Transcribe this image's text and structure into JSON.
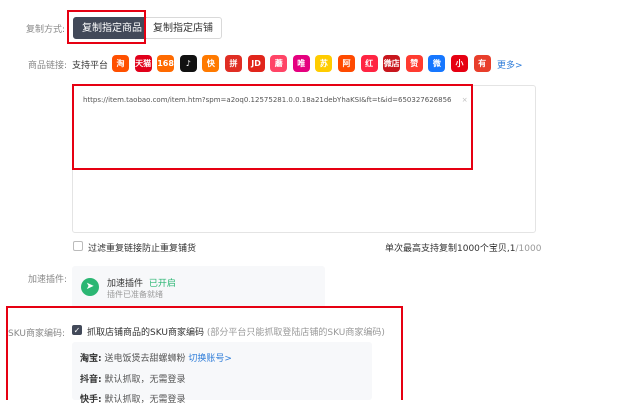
{
  "copy_mode": {
    "label": "复制方式:",
    "primary_button": "复制指定商品",
    "secondary_button": "复制指定店铺"
  },
  "product_link": {
    "label": "商品链接:",
    "support_text": "支持平台",
    "platforms": [
      {
        "name": "taobao-icon",
        "text": "淘",
        "color": "#ff5000"
      },
      {
        "name": "tmall-icon",
        "text": "天猫",
        "color": "#e1001a"
      },
      {
        "name": "1688-icon",
        "text": "1688",
        "color": "#ff6a00"
      },
      {
        "name": "douyin-icon",
        "text": "♪",
        "color": "#111111"
      },
      {
        "name": "kuaishou-icon",
        "text": "快",
        "color": "#ff7a00"
      },
      {
        "name": "pinduoduo-icon",
        "text": "拼",
        "color": "#e02e24"
      },
      {
        "name": "jd-icon",
        "text": "JD",
        "color": "#e1251b"
      },
      {
        "name": "mogujie-icon",
        "text": "蘑",
        "color": "#ff4466"
      },
      {
        "name": "vip-icon",
        "text": "唯",
        "color": "#e5007f"
      },
      {
        "name": "suning-icon",
        "text": "苏",
        "color": "#ffcc00"
      },
      {
        "name": "alibaba-icon",
        "text": "阿",
        "color": "#ff4a00"
      },
      {
        "name": "xiaohongshu-icon",
        "text": "红",
        "color": "#ff2442"
      },
      {
        "name": "weidian-icon",
        "text": "微店",
        "color": "#c8161d"
      },
      {
        "name": "like-icon",
        "text": "赞",
        "color": "#ff3b30"
      },
      {
        "name": "weidian-blue-icon",
        "text": "微",
        "color": "#1677ff"
      },
      {
        "name": "xiaohongshu-app-icon",
        "text": "小",
        "color": "#e60012"
      },
      {
        "name": "youzan-icon",
        "text": "有",
        "color": "#e83e2b"
      }
    ],
    "more_link": "更多>",
    "url_value": "https://item.taobao.com/item.htm?spm=a2oq0.12575281.0.0.18a21debYhaKSI&ft=t&id=650327626856",
    "url_close": "×",
    "filter_checkbox_label": "过滤重复链接防止重复铺货",
    "limit_text": "单次最高支持复制1000个宝贝,",
    "counter_current": "1",
    "counter_total": "/1000"
  },
  "accelerator": {
    "label": "加速插件:",
    "title": "加速插件",
    "status": "已开启",
    "subtitle": "插件已准备就绪",
    "status_color": "#2bb673"
  },
  "sku": {
    "label": "SKU商家编码:",
    "checkbox_label": "抓取店铺商品的SKU商家编码",
    "checkbox_note": "(部分平台只能抓取登陆店铺的SKU商家编码)",
    "rows": [
      {
        "platform": "淘宝:",
        "value": "送电饭煲去甜螺蛳粉",
        "link": "切换账号>"
      },
      {
        "platform": "抖音:",
        "value": "默认抓取，无需登录",
        "link": ""
      },
      {
        "platform": "快手:",
        "value": "默认抓取，无需登录",
        "link": ""
      }
    ]
  },
  "highlight_color": "#e60012"
}
